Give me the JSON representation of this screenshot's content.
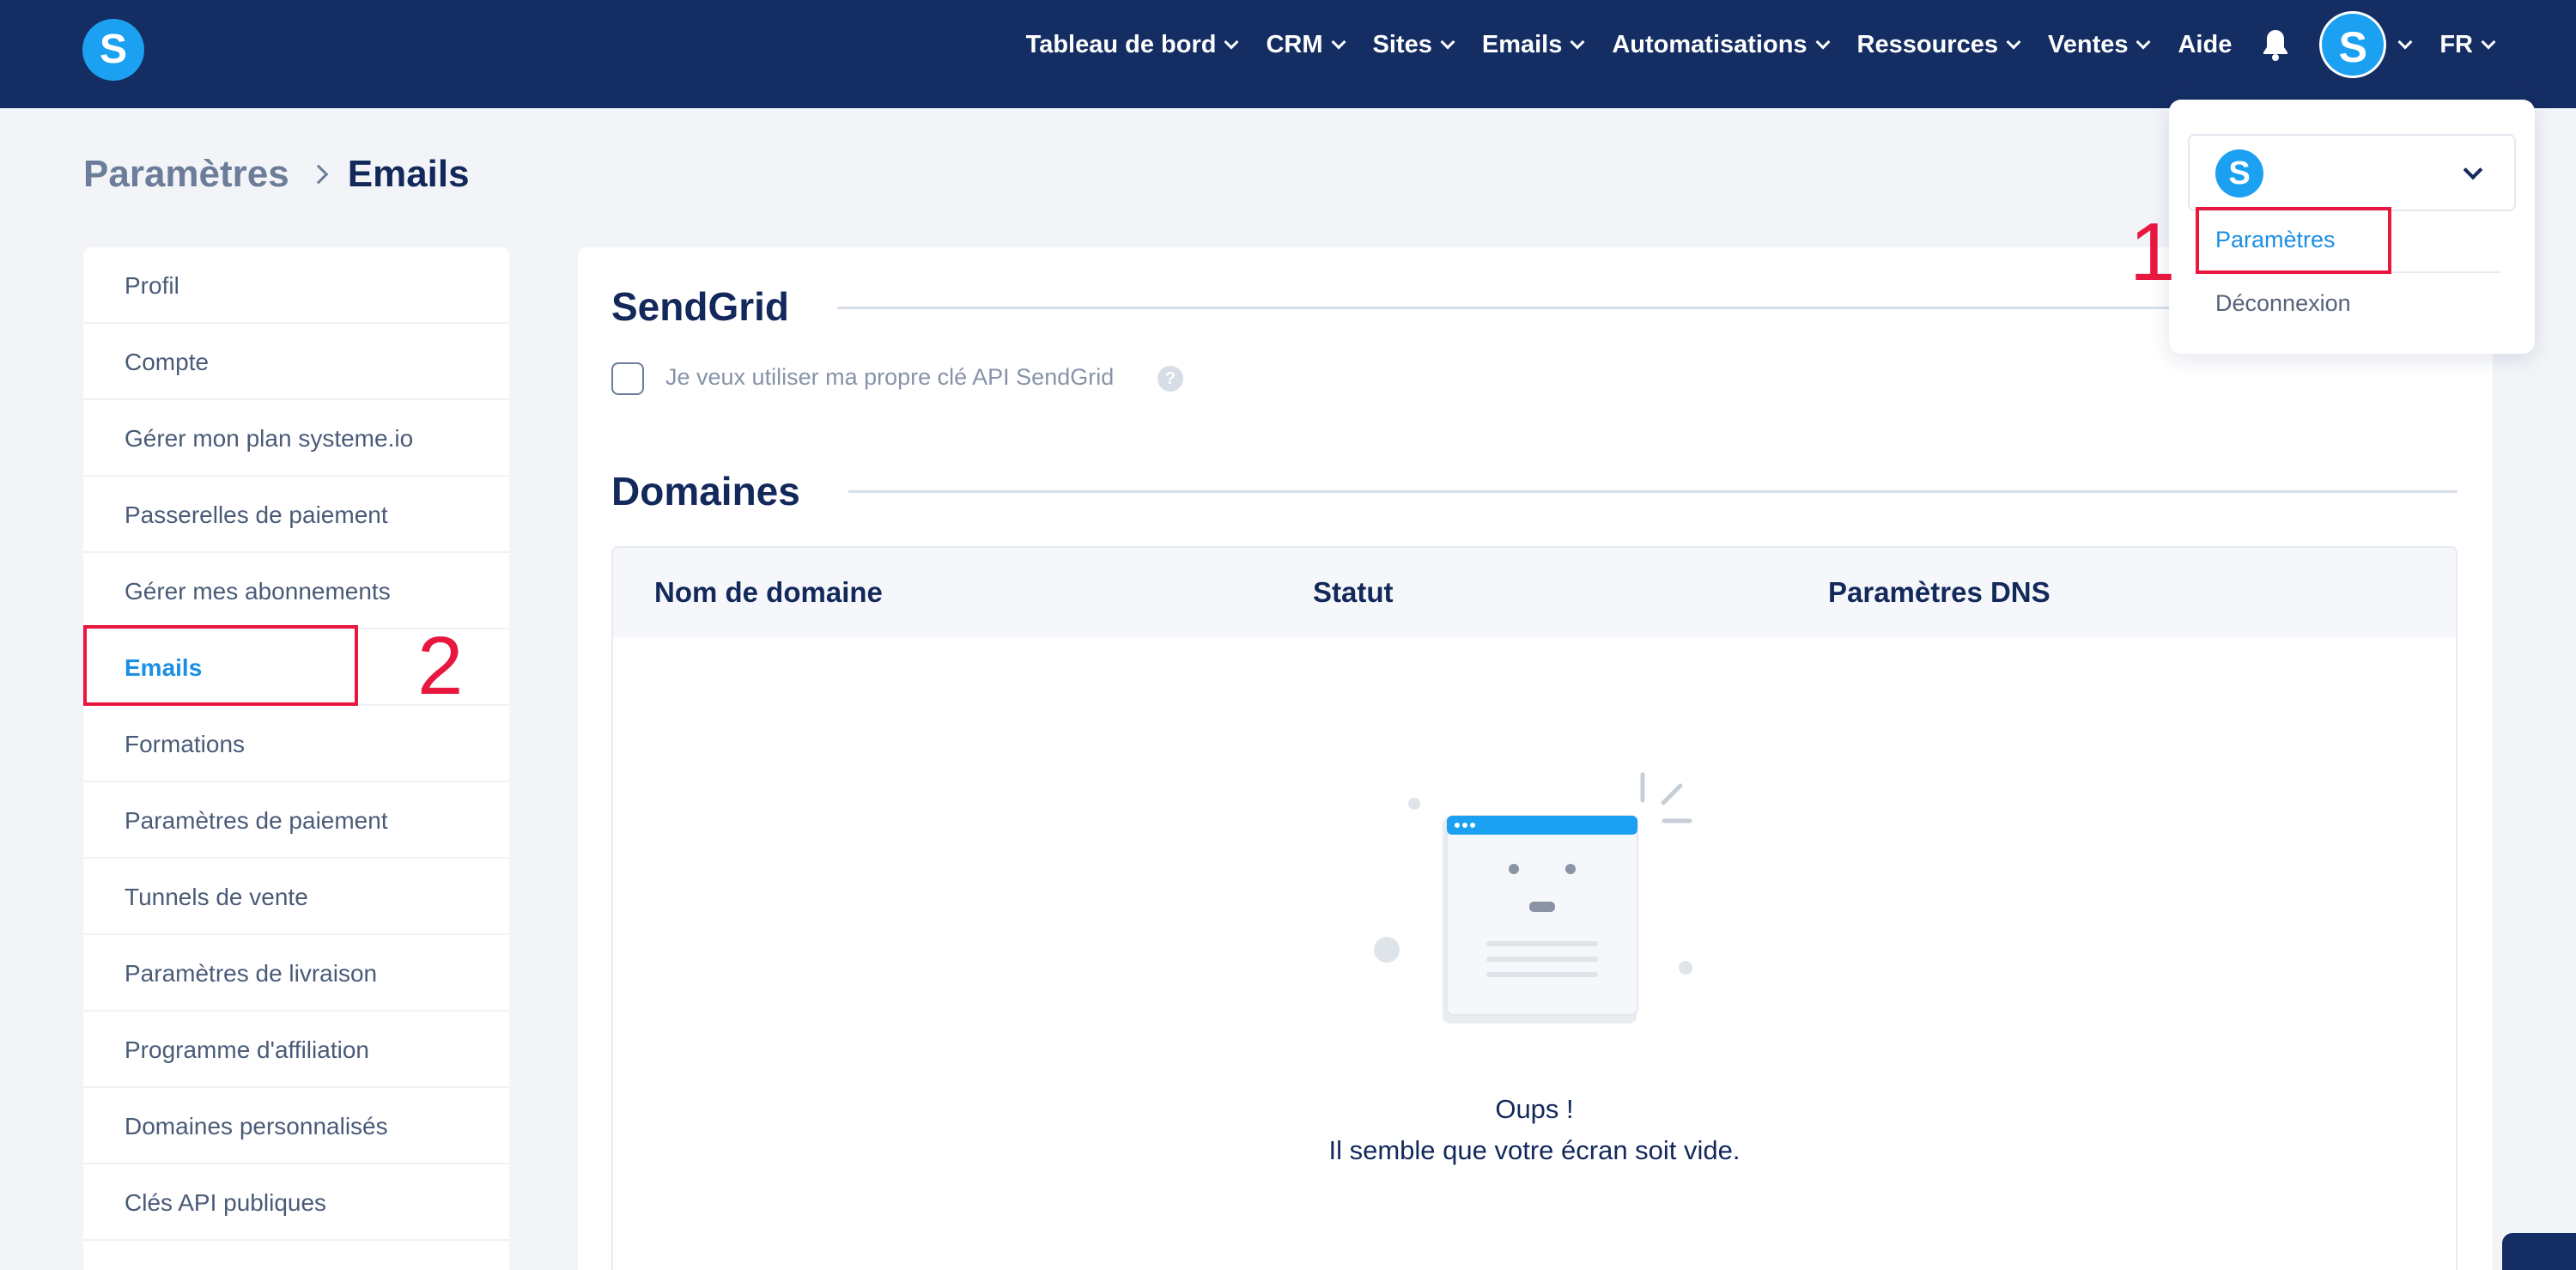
{
  "brand": {
    "logo_letter": "S"
  },
  "topnav": {
    "items": [
      {
        "label": "Tableau de bord"
      },
      {
        "label": "CRM"
      },
      {
        "label": "Sites"
      },
      {
        "label": "Emails"
      },
      {
        "label": "Automatisations"
      },
      {
        "label": "Ressources"
      },
      {
        "label": "Ventes"
      }
    ],
    "help_label": "Aide",
    "avatar_letter": "S",
    "language": "FR"
  },
  "account_menu": {
    "account_letter": "S",
    "settings_label": "Paramètres",
    "logout_label": "Déconnexion"
  },
  "annotations": {
    "step1": "1",
    "step2": "2",
    "highlight_color": "#e8173f"
  },
  "breadcrumb": {
    "root": "Paramètres",
    "current": "Emails"
  },
  "sidebar": {
    "items": [
      {
        "label": "Profil"
      },
      {
        "label": "Compte"
      },
      {
        "label": "Gérer mon plan systeme.io"
      },
      {
        "label": "Passerelles de paiement"
      },
      {
        "label": "Gérer mes abonnements"
      },
      {
        "label": "Emails",
        "active": true
      },
      {
        "label": "Formations"
      },
      {
        "label": "Paramètres de paiement"
      },
      {
        "label": "Tunnels de vente"
      },
      {
        "label": "Paramètres de livraison"
      },
      {
        "label": "Programme d'affiliation"
      },
      {
        "label": "Domaines personnalisés"
      },
      {
        "label": "Clés API publiques"
      }
    ]
  },
  "sendgrid": {
    "title": "SendGrid",
    "checkbox_label": "Je veux utiliser ma propre clé API SendGrid",
    "checked": false
  },
  "domains": {
    "title": "Domaines",
    "columns": [
      "Nom de domaine",
      "Statut",
      "Paramètres DNS"
    ],
    "empty_title": "Oups !",
    "empty_message": "Il semble que votre écran soit vide."
  },
  "colors": {
    "nav_bg": "#142d63",
    "accent": "#1a8fe3",
    "brand_blue": "#1ca1f2"
  }
}
